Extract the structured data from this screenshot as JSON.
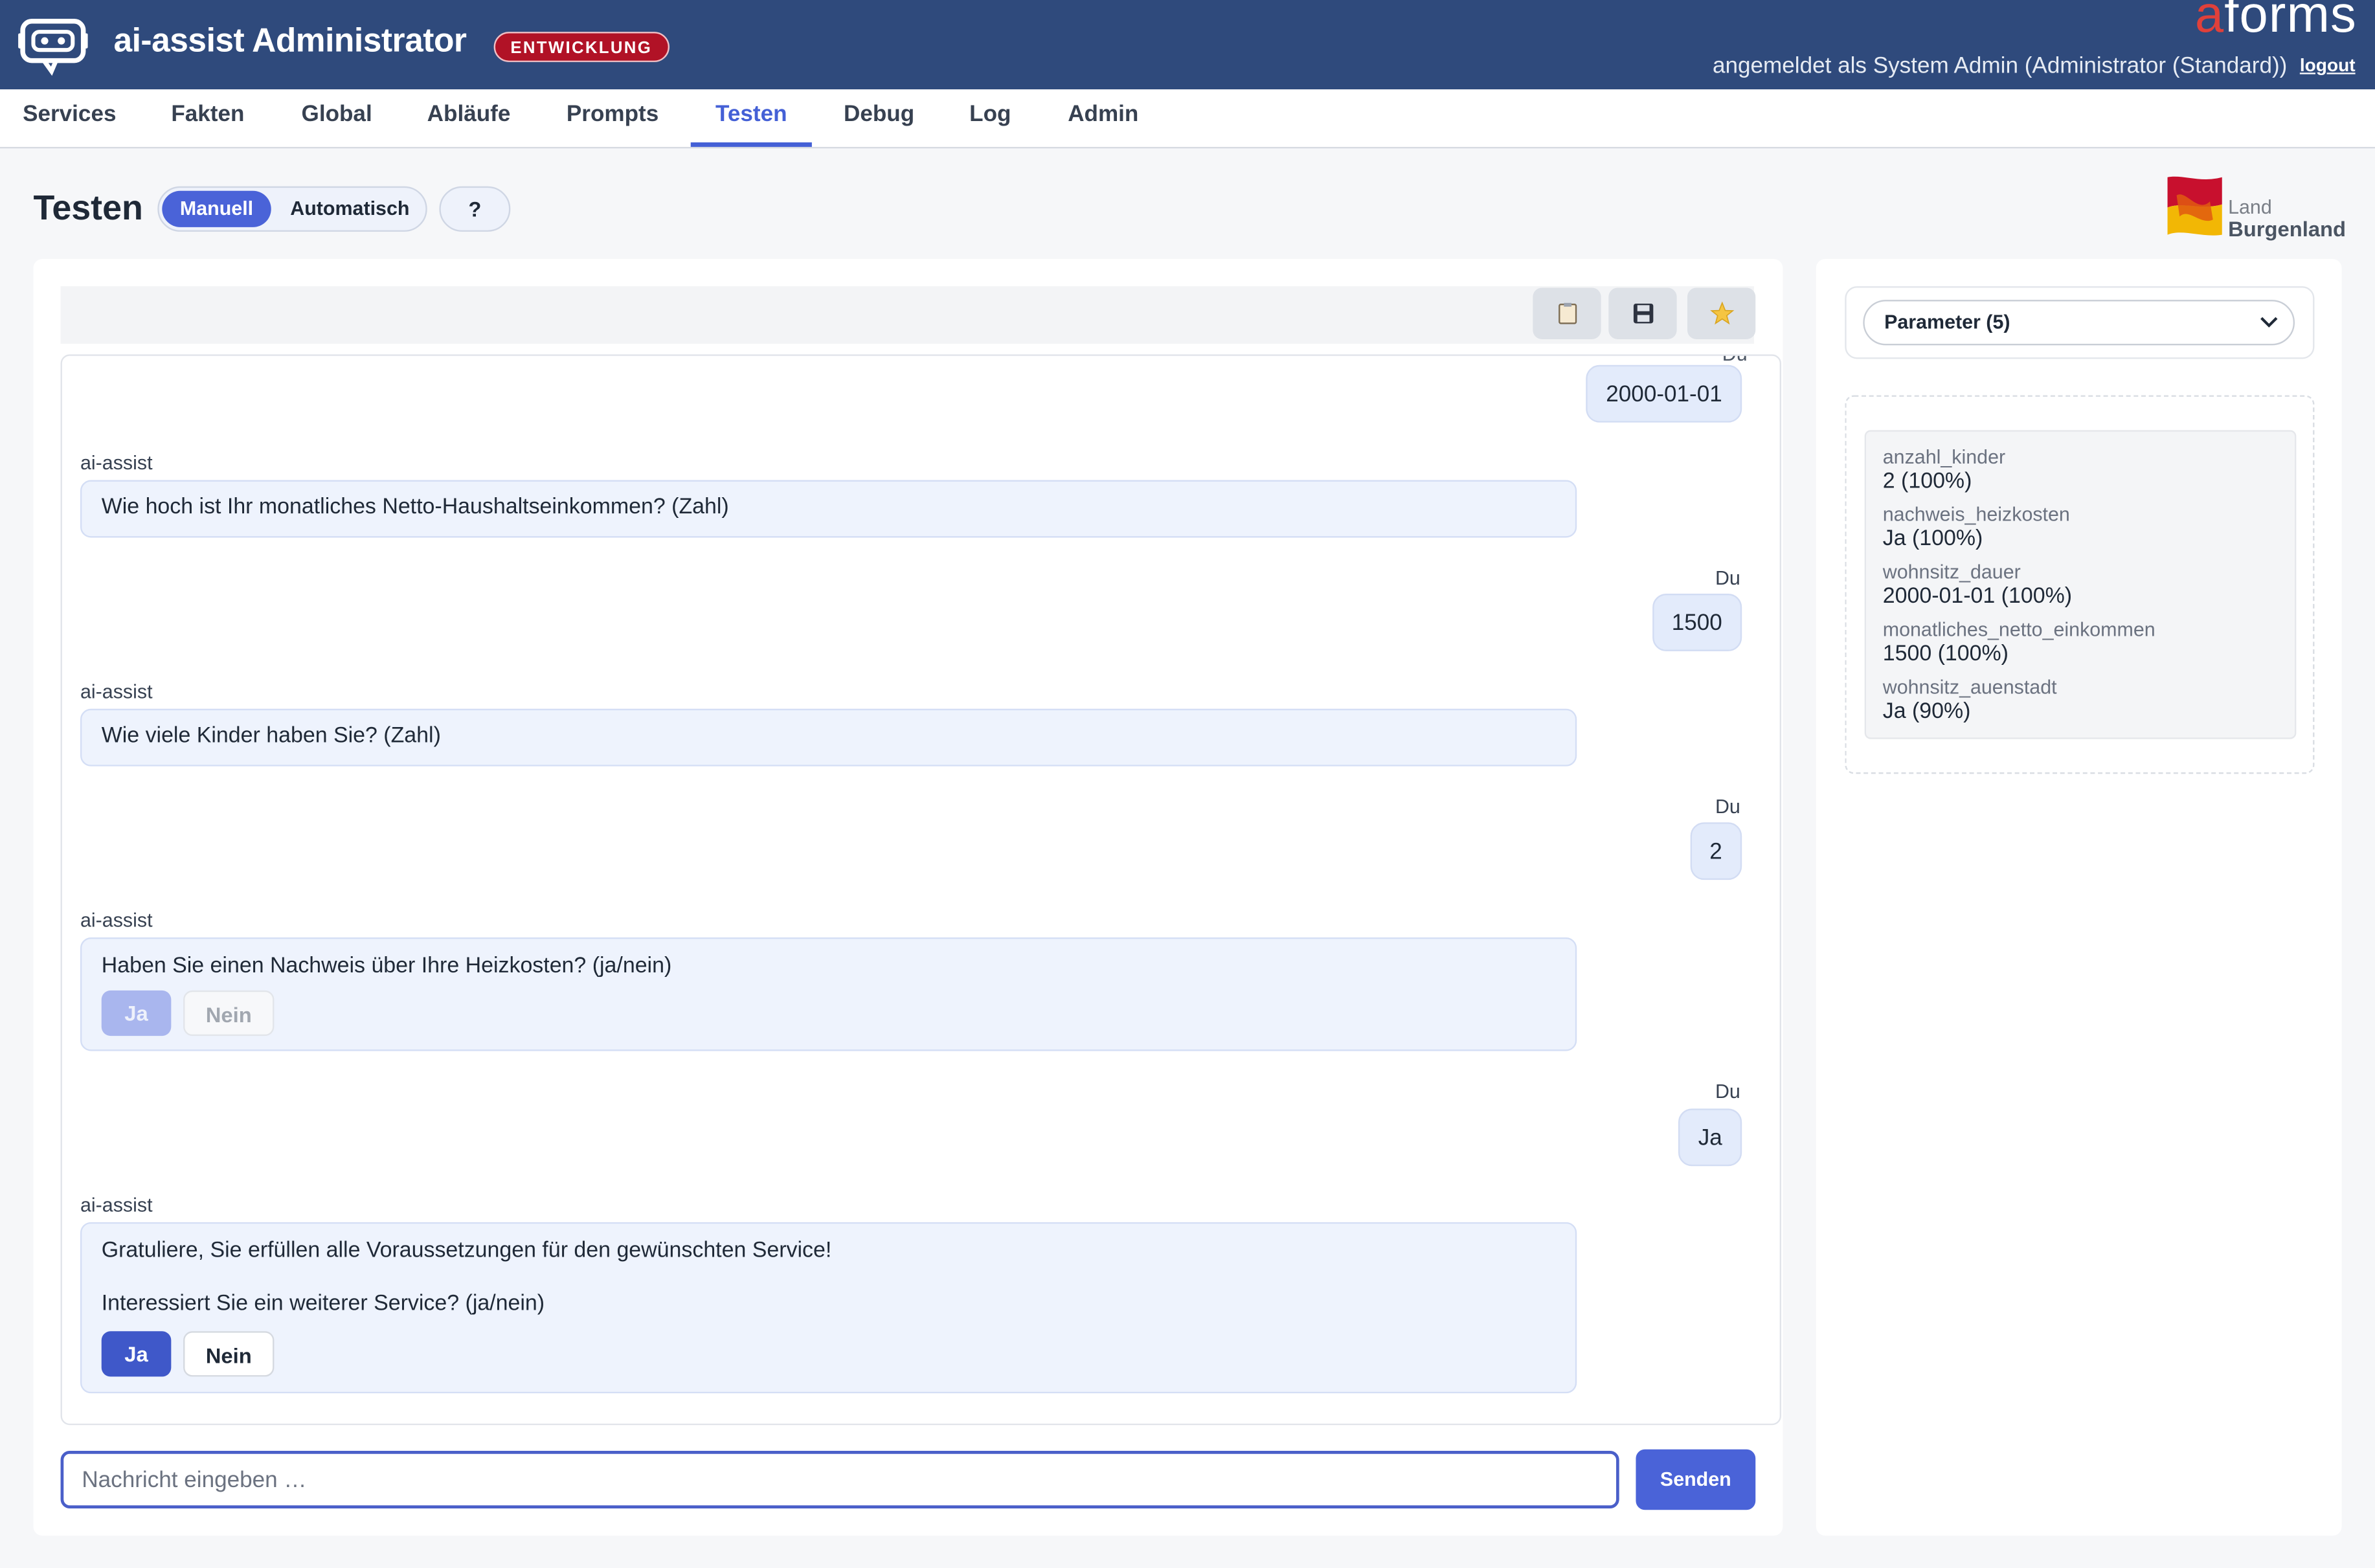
{
  "header": {
    "app_title": "ai-assist Administrator",
    "env_badge": "ENTWICKLUNG",
    "brand_first": "a",
    "brand_rest": "forms",
    "user_text": "angemeldet als System Admin (Administrator (Standard))",
    "logout": "logout"
  },
  "nav": [
    "Services",
    "Fakten",
    "Global",
    "Abläufe",
    "Prompts",
    "Testen",
    "Debug",
    "Log",
    "Admin"
  ],
  "nav_active": "Testen",
  "page": {
    "title": "Testen",
    "mode_manual": "Manuell",
    "mode_auto": "Automatisch",
    "help": "?",
    "logo_land": "Land",
    "logo_name": "Burgenland"
  },
  "chat": {
    "top_cut_label": "Du",
    "messages": [
      {
        "role": "user",
        "label": "Du",
        "text": "2000-01-01"
      },
      {
        "role": "bot",
        "label": "ai-assist",
        "text": "Wie hoch ist Ihr monatliches Netto-Haushaltseinkommen? (Zahl)"
      },
      {
        "role": "user",
        "label": "Du",
        "text": "1500"
      },
      {
        "role": "bot",
        "label": "ai-assist",
        "text": "Wie viele Kinder haben Sie? (Zahl)"
      },
      {
        "role": "user",
        "label": "Du",
        "text": "2"
      },
      {
        "role": "bot",
        "label": "ai-assist",
        "text": "Haben Sie einen Nachweis über Ihre Heizkosten? (ja/nein)",
        "yes": "Ja",
        "no": "Nein"
      },
      {
        "role": "user",
        "label": "Du",
        "text": "Ja"
      },
      {
        "role": "bot",
        "label": "ai-assist",
        "text": "Gratuliere, Sie erfüllen alle Voraussetzungen für den gewünschten Service!",
        "text2": "Interessiert Sie ein weiterer Service? (ja/nein)",
        "yes": "Ja",
        "no": "Nein"
      }
    ],
    "input_placeholder": "Nachricht eingeben …",
    "send": "Senden"
  },
  "toolbar": {
    "icons": [
      "clipboard-icon",
      "save-icon",
      "star-icon"
    ]
  },
  "params": {
    "select_label": "Parameter (5)",
    "facts": [
      {
        "key": "anzahl_kinder",
        "value": "2 (100%)"
      },
      {
        "key": "nachweis_heizkosten",
        "value": "Ja (100%)"
      },
      {
        "key": "wohnsitz_dauer",
        "value": "2000-01-01 (100%)"
      },
      {
        "key": "monatliches_netto_einkommen",
        "value": "1500 (100%)"
      },
      {
        "key": "wohnsitz_auenstadt",
        "value": "Ja (90%)"
      }
    ]
  },
  "colors": {
    "header": "#2f4a7c",
    "accent": "#4a63d8",
    "badge": "#b11226",
    "brand_a": "#e0403a"
  }
}
